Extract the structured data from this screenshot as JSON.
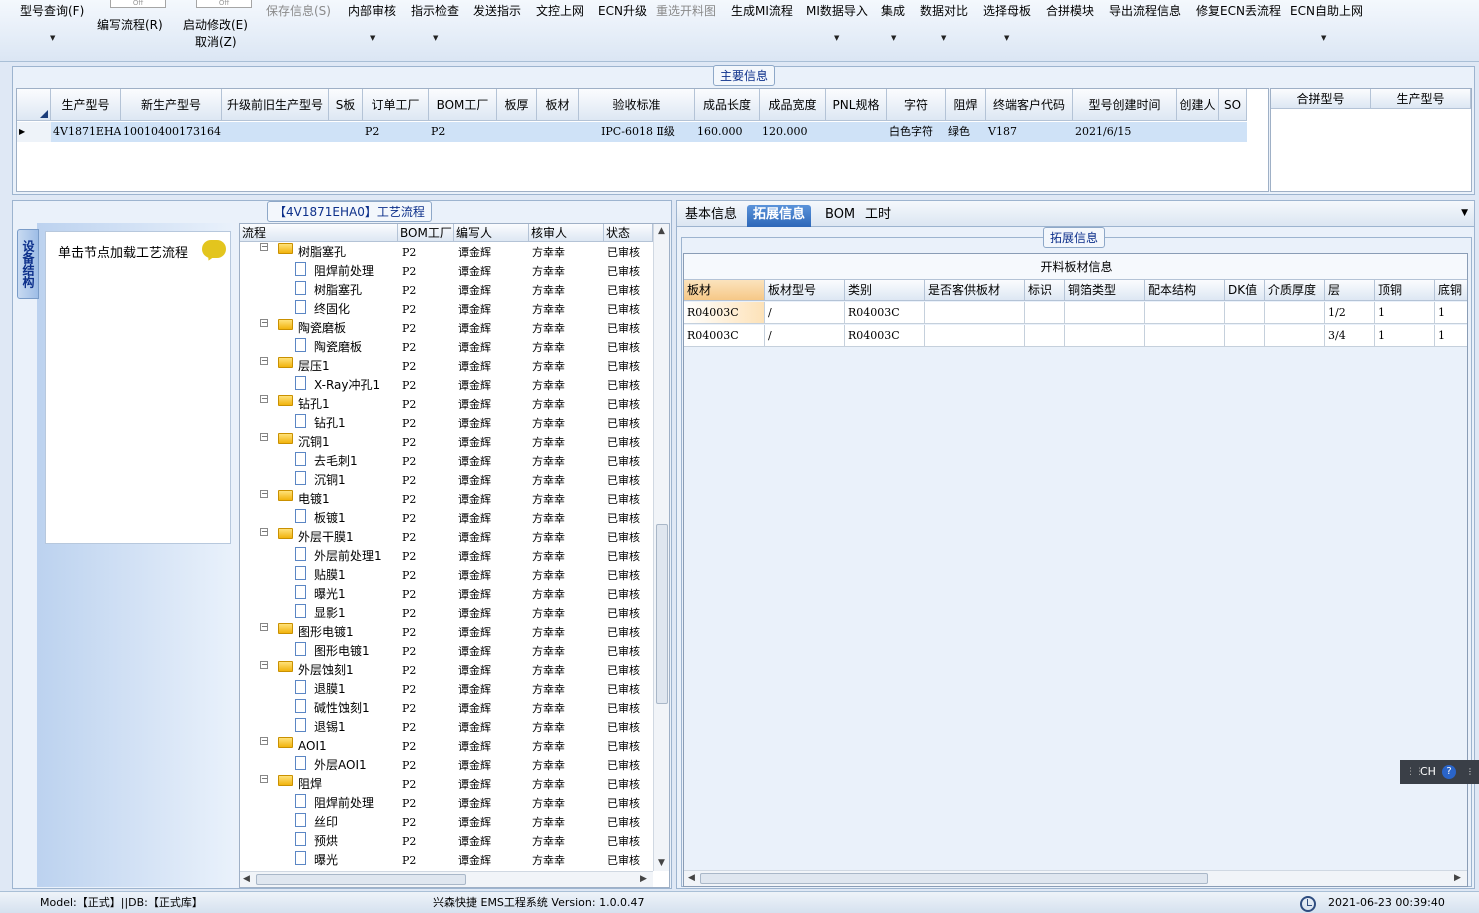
{
  "toolbar": {
    "items": [
      {
        "label": "型号查询(F)",
        "enabled": true,
        "dropdown": true
      },
      {
        "label": "编写流程(R)",
        "enabled": true,
        "dropdown": false
      },
      {
        "label": "启动修改(E)",
        "enabled": true,
        "dropdown": false
      },
      {
        "label": "取消(Z)",
        "enabled": true,
        "dropdown": false
      },
      {
        "label": "保存信息(S)",
        "enabled": false,
        "dropdown": false
      },
      {
        "label": "内部审核",
        "enabled": true,
        "dropdown": true
      },
      {
        "label": "指示检查",
        "enabled": true,
        "dropdown": true
      },
      {
        "label": "发送指示",
        "enabled": true,
        "dropdown": false
      },
      {
        "label": "文控上网",
        "enabled": true,
        "dropdown": false
      },
      {
        "label": "ECN升级",
        "enabled": true,
        "dropdown": false
      },
      {
        "label": "重选开料图",
        "enabled": false,
        "dropdown": false
      },
      {
        "label": "生成MI流程",
        "enabled": true,
        "dropdown": false
      },
      {
        "label": "MI数据导入",
        "enabled": true,
        "dropdown": true
      },
      {
        "label": "集成",
        "enabled": true,
        "dropdown": true
      },
      {
        "label": "数据对比",
        "enabled": true,
        "dropdown": true
      },
      {
        "label": "选择母板",
        "enabled": true,
        "dropdown": true
      },
      {
        "label": "合拼模块",
        "enabled": true,
        "dropdown": false
      },
      {
        "label": "导出流程信息",
        "enabled": true,
        "dropdown": false
      },
      {
        "label": "修复ECN丢流程",
        "enabled": true,
        "dropdown": false
      },
      {
        "label": "ECN自助上网",
        "enabled": true,
        "dropdown": true
      }
    ],
    "mini_label": "Off"
  },
  "main_info": {
    "caption": "主要信息",
    "columns": [
      "生产型号",
      "新生产型号",
      "升级前旧生产型号",
      "S板",
      "订单工厂",
      "BOM工厂",
      "板厚",
      "板材",
      "验收标准",
      "成品长度",
      "成品宽度",
      "PNL规格",
      "字符",
      "阻焊",
      "终端客户代码",
      "型号创建时间",
      "创建人",
      "SO"
    ],
    "row": [
      "4V1871EHA0",
      "10010400173164",
      "",
      "",
      "P2",
      "P2",
      "",
      "",
      "IPC-6018 Ⅱ级",
      "160.000",
      "120.000",
      "",
      "白色字符",
      "绿色",
      "V187",
      "2021/6/15",
      "",
      ""
    ],
    "merge_columns": [
      "合拼型号",
      "生产型号"
    ]
  },
  "process": {
    "caption": "【4V1871EHA0】工艺流程",
    "side_tab": "设备结构",
    "hint": "单击节点加载工艺流程",
    "columns": [
      "流程",
      "BOM工厂",
      "编写人",
      "核审人",
      "状态"
    ],
    "rows": [
      {
        "level": 0,
        "name": "树脂塞孔",
        "bom": "P2",
        "writer": "谭金辉",
        "reviewer": "方幸幸",
        "status": "已审核"
      },
      {
        "level": 1,
        "name": "阻焊前处理",
        "bom": "P2",
        "writer": "谭金辉",
        "reviewer": "方幸幸",
        "status": "已审核"
      },
      {
        "level": 1,
        "name": "树脂塞孔",
        "bom": "P2",
        "writer": "谭金辉",
        "reviewer": "方幸幸",
        "status": "已审核"
      },
      {
        "level": 1,
        "name": "终固化",
        "bom": "P2",
        "writer": "谭金辉",
        "reviewer": "方幸幸",
        "status": "已审核"
      },
      {
        "level": 0,
        "name": "陶瓷磨板",
        "bom": "P2",
        "writer": "谭金辉",
        "reviewer": "方幸幸",
        "status": "已审核"
      },
      {
        "level": 1,
        "name": "陶瓷磨板",
        "bom": "P2",
        "writer": "谭金辉",
        "reviewer": "方幸幸",
        "status": "已审核"
      },
      {
        "level": 0,
        "name": "层压1",
        "bom": "P2",
        "writer": "谭金辉",
        "reviewer": "方幸幸",
        "status": "已审核"
      },
      {
        "level": 1,
        "name": "X-Ray冲孔1",
        "bom": "P2",
        "writer": "谭金辉",
        "reviewer": "方幸幸",
        "status": "已审核"
      },
      {
        "level": 0,
        "name": "钻孔1",
        "bom": "P2",
        "writer": "谭金辉",
        "reviewer": "方幸幸",
        "status": "已审核"
      },
      {
        "level": 1,
        "name": "钻孔1",
        "bom": "P2",
        "writer": "谭金辉",
        "reviewer": "方幸幸",
        "status": "已审核"
      },
      {
        "level": 0,
        "name": "沉铜1",
        "bom": "P2",
        "writer": "谭金辉",
        "reviewer": "方幸幸",
        "status": "已审核"
      },
      {
        "level": 1,
        "name": "去毛刺1",
        "bom": "P2",
        "writer": "谭金辉",
        "reviewer": "方幸幸",
        "status": "已审核"
      },
      {
        "level": 1,
        "name": "沉铜1",
        "bom": "P2",
        "writer": "谭金辉",
        "reviewer": "方幸幸",
        "status": "已审核"
      },
      {
        "level": 0,
        "name": "电镀1",
        "bom": "P2",
        "writer": "谭金辉",
        "reviewer": "方幸幸",
        "status": "已审核"
      },
      {
        "level": 1,
        "name": "板镀1",
        "bom": "P2",
        "writer": "谭金辉",
        "reviewer": "方幸幸",
        "status": "已审核"
      },
      {
        "level": 0,
        "name": "外层干膜1",
        "bom": "P2",
        "writer": "谭金辉",
        "reviewer": "方幸幸",
        "status": "已审核"
      },
      {
        "level": 1,
        "name": "外层前处理1",
        "bom": "P2",
        "writer": "谭金辉",
        "reviewer": "方幸幸",
        "status": "已审核"
      },
      {
        "level": 1,
        "name": "贴膜1",
        "bom": "P2",
        "writer": "谭金辉",
        "reviewer": "方幸幸",
        "status": "已审核"
      },
      {
        "level": 1,
        "name": "曝光1",
        "bom": "P2",
        "writer": "谭金辉",
        "reviewer": "方幸幸",
        "status": "已审核"
      },
      {
        "level": 1,
        "name": "显影1",
        "bom": "P2",
        "writer": "谭金辉",
        "reviewer": "方幸幸",
        "status": "已审核"
      },
      {
        "level": 0,
        "name": "图形电镀1",
        "bom": "P2",
        "writer": "谭金辉",
        "reviewer": "方幸幸",
        "status": "已审核"
      },
      {
        "level": 1,
        "name": "图形电镀1",
        "bom": "P2",
        "writer": "谭金辉",
        "reviewer": "方幸幸",
        "status": "已审核"
      },
      {
        "level": 0,
        "name": "外层蚀刻1",
        "bom": "P2",
        "writer": "谭金辉",
        "reviewer": "方幸幸",
        "status": "已审核"
      },
      {
        "level": 1,
        "name": "退膜1",
        "bom": "P2",
        "writer": "谭金辉",
        "reviewer": "方幸幸",
        "status": "已审核"
      },
      {
        "level": 1,
        "name": "碱性蚀刻1",
        "bom": "P2",
        "writer": "谭金辉",
        "reviewer": "方幸幸",
        "status": "已审核"
      },
      {
        "level": 1,
        "name": "退锡1",
        "bom": "P2",
        "writer": "谭金辉",
        "reviewer": "方幸幸",
        "status": "已审核"
      },
      {
        "level": 0,
        "name": "AOI1",
        "bom": "P2",
        "writer": "谭金辉",
        "reviewer": "方幸幸",
        "status": "已审核"
      },
      {
        "level": 1,
        "name": "外层AOI1",
        "bom": "P2",
        "writer": "谭金辉",
        "reviewer": "方幸幸",
        "status": "已审核"
      },
      {
        "level": 0,
        "name": "阻焊",
        "bom": "P2",
        "writer": "谭金辉",
        "reviewer": "方幸幸",
        "status": "已审核"
      },
      {
        "level": 1,
        "name": "阻焊前处理",
        "bom": "P2",
        "writer": "谭金辉",
        "reviewer": "方幸幸",
        "status": "已审核"
      },
      {
        "level": 1,
        "name": "丝印",
        "bom": "P2",
        "writer": "谭金辉",
        "reviewer": "方幸幸",
        "status": "已审核"
      },
      {
        "level": 1,
        "name": "预烘",
        "bom": "P2",
        "writer": "谭金辉",
        "reviewer": "方幸幸",
        "status": "已审核"
      },
      {
        "level": 1,
        "name": "曝光",
        "bom": "P2",
        "writer": "谭金辉",
        "reviewer": "方幸幸",
        "status": "已审核"
      }
    ]
  },
  "detail": {
    "tabs": [
      "基本信息",
      "拓展信息",
      "BOM",
      "工时"
    ],
    "active_tab": 1,
    "caption": "拓展信息",
    "table_title": "开料板材信息",
    "columns": [
      "板材",
      "板材型号",
      "类别",
      "是否客供板材",
      "标识",
      "铜箔类型",
      "配本结构",
      "DK值",
      "介质厚度",
      "层",
      "顶铜",
      "底铜"
    ],
    "rows": [
      [
        "R04003C",
        "/",
        "R04003C",
        "",
        "",
        "",
        "",
        "",
        "",
        "1/2",
        "1",
        "1"
      ],
      [
        "R04003C",
        "/",
        "R04003C",
        "",
        "",
        "",
        "",
        "",
        "",
        "3/4",
        "1",
        "1"
      ]
    ]
  },
  "ime": {
    "label": "CH",
    "help": "?"
  },
  "status": {
    "model": "Model:【正式】||DB:【正式库】",
    "system": "兴森快捷 EMS工程系统 Version: 1.0.0.47",
    "datetime": "2021-06-23 00:39:40"
  }
}
